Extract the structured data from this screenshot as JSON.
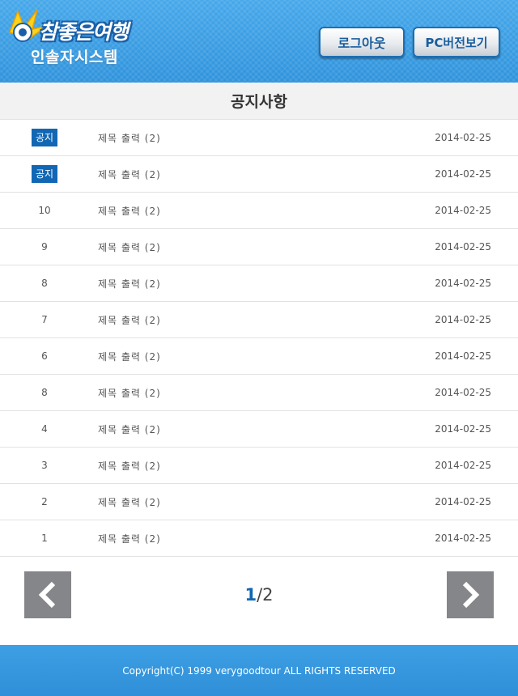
{
  "header": {
    "logo_script": "참좋은여행",
    "logo_sub": "인솔자시스템",
    "logout_label": "로그아웃",
    "pc_view_label": "PC버전보기"
  },
  "page_title": "공지사항",
  "notices": [
    {
      "num": "공지",
      "is_pinned": true,
      "title": "제목 출력 (2)",
      "date": "2014-02-25"
    },
    {
      "num": "공지",
      "is_pinned": true,
      "title": "제목 출력 (2)",
      "date": "2014-02-25"
    },
    {
      "num": "10",
      "is_pinned": false,
      "title": "제목 출력 (2)",
      "date": "2014-02-25"
    },
    {
      "num": "9",
      "is_pinned": false,
      "title": "제목 출력 (2)",
      "date": "2014-02-25"
    },
    {
      "num": "8",
      "is_pinned": false,
      "title": "제목 출력 (2)",
      "date": "2014-02-25"
    },
    {
      "num": "7",
      "is_pinned": false,
      "title": "제목 출력 (2)",
      "date": "2014-02-25"
    },
    {
      "num": "6",
      "is_pinned": false,
      "title": "제목 출력 (2)",
      "date": "2014-02-25"
    },
    {
      "num": "8",
      "is_pinned": false,
      "title": "제목 출력 (2)",
      "date": "2014-02-25"
    },
    {
      "num": "4",
      "is_pinned": false,
      "title": "제목 출력 (2)",
      "date": "2014-02-25"
    },
    {
      "num": "3",
      "is_pinned": false,
      "title": "제목 출력 (2)",
      "date": "2014-02-25"
    },
    {
      "num": "2",
      "is_pinned": false,
      "title": "제목 출력 (2)",
      "date": "2014-02-25"
    },
    {
      "num": "1",
      "is_pinned": false,
      "title": "제목 출력 (2)",
      "date": "2014-02-25"
    }
  ],
  "pagination": {
    "current": "1",
    "separator": "/",
    "total": "2",
    "prev_icon": "chevron-left-icon",
    "next_icon": "chevron-right-icon"
  },
  "footer": {
    "copyright": "Copyright(C) 1999 verygoodtour ALL RIGHTS RESERVED"
  },
  "colors": {
    "header_blue": "#3a9ee3",
    "badge_blue": "#1167b4",
    "pager_gray": "#84868a"
  }
}
